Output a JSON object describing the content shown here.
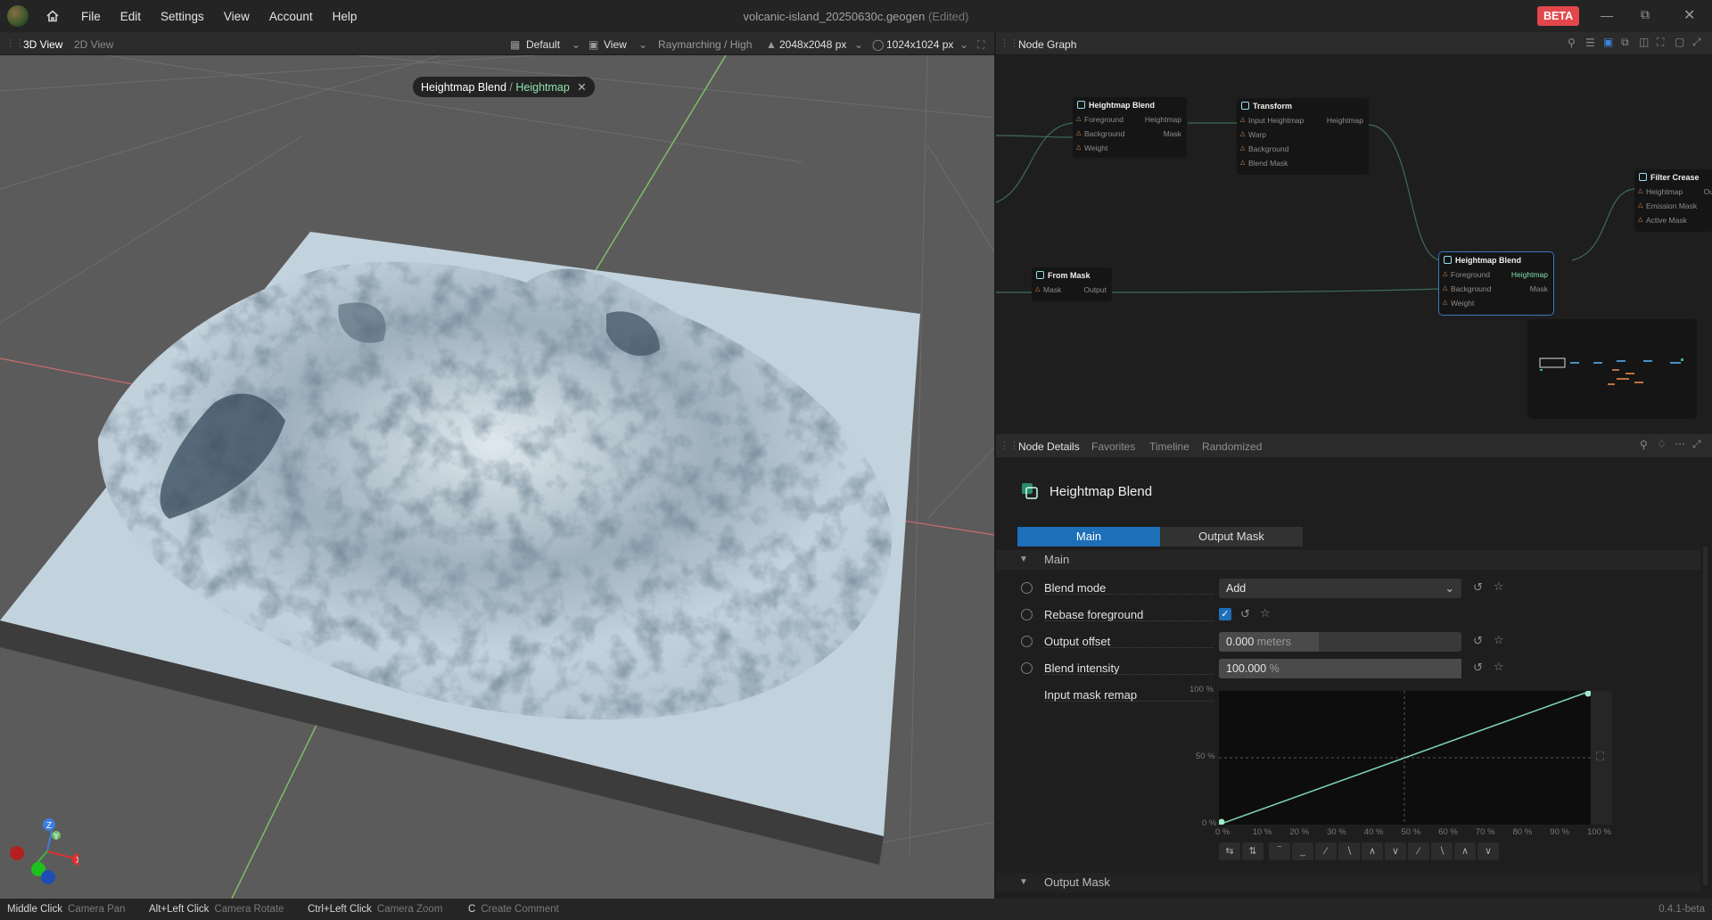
{
  "window": {
    "title": "volcanic-island_20250630c.geogen",
    "title_suffix": "(Edited)",
    "beta_badge": "BETA",
    "menu": [
      "File",
      "Edit",
      "Settings",
      "View",
      "Account",
      "Help"
    ]
  },
  "viewport_toolbar": {
    "tabs": [
      "3D View",
      "2D View"
    ],
    "layout": "Default",
    "view": "View",
    "render_mode": "Raymarching / High",
    "resolution": "2048x2048 px",
    "preview_resolution": "1024x1024 px"
  },
  "viewport": {
    "tag_node": "Heightmap Blend",
    "tag_sep": "/",
    "tag_output": "Heightmap",
    "axes": [
      "Z",
      "Y",
      "X"
    ]
  },
  "node_graph": {
    "title": "Node Graph",
    "nodes": {
      "hb1": {
        "title": "Heightmap Blend",
        "in": [
          "Foreground",
          "Background",
          "Weight"
        ],
        "out": [
          "Heightmap",
          "Mask"
        ]
      },
      "transform": {
        "title": "Transform",
        "in": [
          "Input Heightmap",
          "Warp",
          "Background",
          "Blend Mask"
        ],
        "out": [
          "Heightmap"
        ]
      },
      "filter": {
        "title": "Filter Crease",
        "in": [
          "Heightmap",
          "Emission Mask",
          "Active Mask"
        ],
        "out": [
          "Ou"
        ]
      },
      "frommask": {
        "title": "From Mask",
        "in": [
          "Mask"
        ],
        "out": [
          "Output"
        ]
      },
      "hb2": {
        "title": "Heightmap Blend",
        "in": [
          "Foreground",
          "Background",
          "Weight"
        ],
        "out": [
          "Heightmap",
          "Mask"
        ]
      }
    }
  },
  "details": {
    "tabs": [
      "Node Details",
      "Favorites",
      "Timeline",
      "Randomized"
    ],
    "node_title": "Heightmap Blend",
    "subtabs": [
      "Main",
      "Output Mask"
    ],
    "section_main": "Main",
    "section_output_mask": "Output Mask",
    "blend_mode": {
      "label": "Blend mode",
      "value": "Add"
    },
    "rebase": {
      "label": "Rebase foreground",
      "checked": true
    },
    "output_offset": {
      "label": "Output offset",
      "value": "0.000",
      "unit": "meters",
      "fill": 0.41
    },
    "blend_intensity": {
      "label": "Blend intensity",
      "value": "100.000",
      "unit": "%",
      "fill": 1.0
    },
    "mask_remap": {
      "label": "Input mask remap"
    },
    "curve": {
      "y_ticks": [
        "100 %",
        "50 %",
        "0 %"
      ],
      "x_ticks": [
        "0 %",
        "10 %",
        "20 %",
        "30 %",
        "40 %",
        "50 %",
        "60 %",
        "70 %",
        "80 %",
        "90 %",
        "100 %"
      ],
      "points": [
        [
          0,
          0
        ],
        [
          100,
          100
        ]
      ]
    }
  },
  "statusbar": {
    "hints": [
      {
        "key": "Middle Click",
        "desc": "Camera Pan"
      },
      {
        "key": "Alt+Left Click",
        "desc": "Camera Rotate"
      },
      {
        "key": "Ctrl+Left Click",
        "desc": "Camera Zoom"
      },
      {
        "key": "C",
        "desc": "Create Comment"
      }
    ],
    "version": "0.4.1-beta"
  }
}
